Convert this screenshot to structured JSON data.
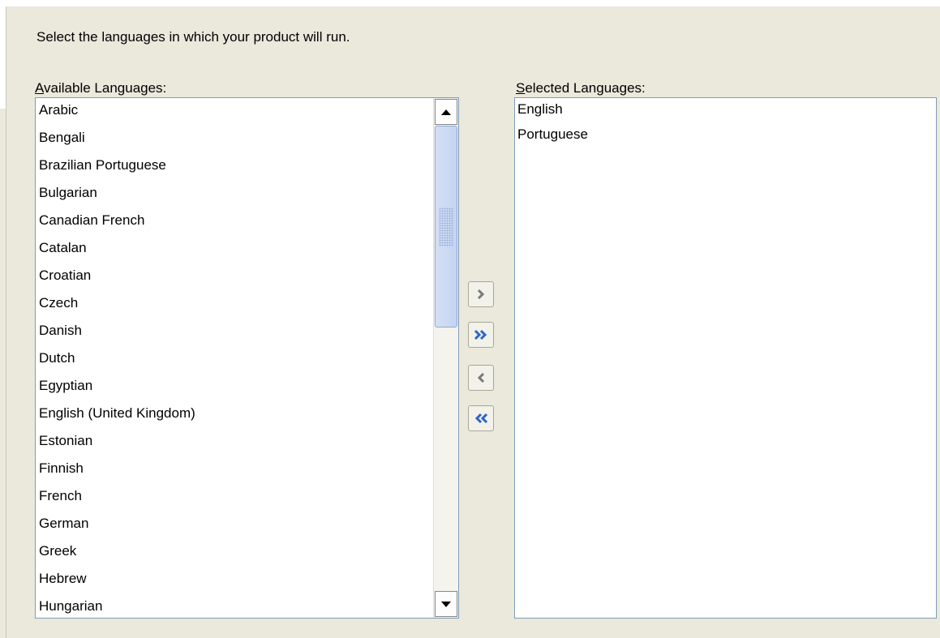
{
  "instruction": "Select the languages in which your product will run.",
  "available": {
    "label_prefix": "A",
    "label_rest": "vailable Languages:",
    "items": [
      "Arabic",
      "Bengali",
      "Brazilian Portuguese",
      "Bulgarian",
      "Canadian French",
      "Catalan",
      "Croatian",
      "Czech",
      "Danish",
      "Dutch",
      "Egyptian",
      "English (United Kingdom)",
      "Estonian",
      "Finnish",
      "French",
      "German",
      "Greek",
      "Hebrew",
      "Hungarian"
    ]
  },
  "selected": {
    "label_prefix": "S",
    "label_rest": "elected Languages:",
    "items": [
      "English",
      "Portuguese"
    ]
  },
  "buttons": {
    "move": "move-selected-right-icon",
    "move_all": "move-all-right-icon",
    "remove": "move-selected-left-icon",
    "remove_all": "move-all-left-icon"
  },
  "colors": {
    "background": "#ebe8dc",
    "list_border": "#7f9db9",
    "shuttle_active": "#2a66c8",
    "shuttle_disabled": "#7a7a7a"
  }
}
